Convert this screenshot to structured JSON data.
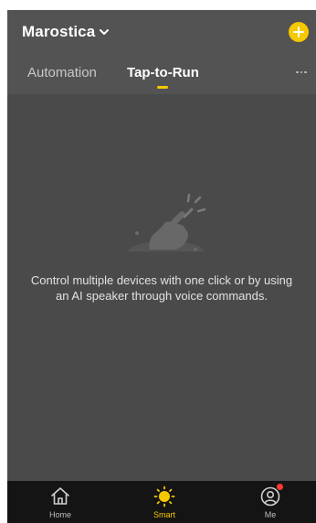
{
  "header": {
    "home_name": "Marostica",
    "tabs": [
      {
        "label": "Automation",
        "active": false
      },
      {
        "label": "Tap-to-Run",
        "active": true
      }
    ]
  },
  "empty_state": {
    "message": "Control multiple devices with one click or by using an AI speaker through voice commands."
  },
  "bottom_nav": {
    "items": [
      {
        "label": "Home",
        "icon": "home-icon",
        "active": false
      },
      {
        "label": "Smart",
        "icon": "sun-icon",
        "active": true
      },
      {
        "label": "Me",
        "icon": "user-icon",
        "active": false,
        "badge": true
      }
    ]
  },
  "colors": {
    "accent": "#f5c800",
    "background": "#4a4a4a",
    "header": "#535353",
    "nav_bar": "#141414",
    "badge": "#ff3b30"
  }
}
